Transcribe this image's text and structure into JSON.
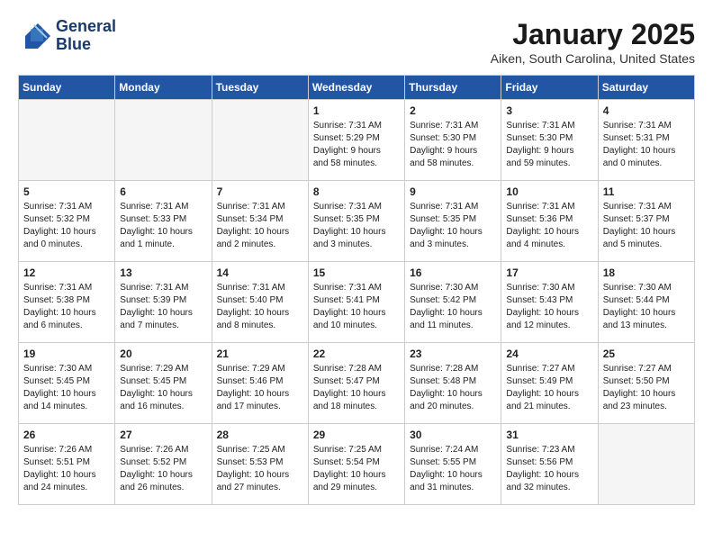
{
  "header": {
    "logo_line1": "General",
    "logo_line2": "Blue",
    "title": "January 2025",
    "subtitle": "Aiken, South Carolina, United States"
  },
  "weekdays": [
    "Sunday",
    "Monday",
    "Tuesday",
    "Wednesday",
    "Thursday",
    "Friday",
    "Saturday"
  ],
  "weeks": [
    [
      {
        "day": "",
        "info": ""
      },
      {
        "day": "",
        "info": ""
      },
      {
        "day": "",
        "info": ""
      },
      {
        "day": "1",
        "info": "Sunrise: 7:31 AM\nSunset: 5:29 PM\nDaylight: 9 hours\nand 58 minutes."
      },
      {
        "day": "2",
        "info": "Sunrise: 7:31 AM\nSunset: 5:30 PM\nDaylight: 9 hours\nand 58 minutes."
      },
      {
        "day": "3",
        "info": "Sunrise: 7:31 AM\nSunset: 5:30 PM\nDaylight: 9 hours\nand 59 minutes."
      },
      {
        "day": "4",
        "info": "Sunrise: 7:31 AM\nSunset: 5:31 PM\nDaylight: 10 hours\nand 0 minutes."
      }
    ],
    [
      {
        "day": "5",
        "info": "Sunrise: 7:31 AM\nSunset: 5:32 PM\nDaylight: 10 hours\nand 0 minutes."
      },
      {
        "day": "6",
        "info": "Sunrise: 7:31 AM\nSunset: 5:33 PM\nDaylight: 10 hours\nand 1 minute."
      },
      {
        "day": "7",
        "info": "Sunrise: 7:31 AM\nSunset: 5:34 PM\nDaylight: 10 hours\nand 2 minutes."
      },
      {
        "day": "8",
        "info": "Sunrise: 7:31 AM\nSunset: 5:35 PM\nDaylight: 10 hours\nand 3 minutes."
      },
      {
        "day": "9",
        "info": "Sunrise: 7:31 AM\nSunset: 5:35 PM\nDaylight: 10 hours\nand 3 minutes."
      },
      {
        "day": "10",
        "info": "Sunrise: 7:31 AM\nSunset: 5:36 PM\nDaylight: 10 hours\nand 4 minutes."
      },
      {
        "day": "11",
        "info": "Sunrise: 7:31 AM\nSunset: 5:37 PM\nDaylight: 10 hours\nand 5 minutes."
      }
    ],
    [
      {
        "day": "12",
        "info": "Sunrise: 7:31 AM\nSunset: 5:38 PM\nDaylight: 10 hours\nand 6 minutes."
      },
      {
        "day": "13",
        "info": "Sunrise: 7:31 AM\nSunset: 5:39 PM\nDaylight: 10 hours\nand 7 minutes."
      },
      {
        "day": "14",
        "info": "Sunrise: 7:31 AM\nSunset: 5:40 PM\nDaylight: 10 hours\nand 8 minutes."
      },
      {
        "day": "15",
        "info": "Sunrise: 7:31 AM\nSunset: 5:41 PM\nDaylight: 10 hours\nand 10 minutes."
      },
      {
        "day": "16",
        "info": "Sunrise: 7:30 AM\nSunset: 5:42 PM\nDaylight: 10 hours\nand 11 minutes."
      },
      {
        "day": "17",
        "info": "Sunrise: 7:30 AM\nSunset: 5:43 PM\nDaylight: 10 hours\nand 12 minutes."
      },
      {
        "day": "18",
        "info": "Sunrise: 7:30 AM\nSunset: 5:44 PM\nDaylight: 10 hours\nand 13 minutes."
      }
    ],
    [
      {
        "day": "19",
        "info": "Sunrise: 7:30 AM\nSunset: 5:45 PM\nDaylight: 10 hours\nand 14 minutes."
      },
      {
        "day": "20",
        "info": "Sunrise: 7:29 AM\nSunset: 5:45 PM\nDaylight: 10 hours\nand 16 minutes."
      },
      {
        "day": "21",
        "info": "Sunrise: 7:29 AM\nSunset: 5:46 PM\nDaylight: 10 hours\nand 17 minutes."
      },
      {
        "day": "22",
        "info": "Sunrise: 7:28 AM\nSunset: 5:47 PM\nDaylight: 10 hours\nand 18 minutes."
      },
      {
        "day": "23",
        "info": "Sunrise: 7:28 AM\nSunset: 5:48 PM\nDaylight: 10 hours\nand 20 minutes."
      },
      {
        "day": "24",
        "info": "Sunrise: 7:27 AM\nSunset: 5:49 PM\nDaylight: 10 hours\nand 21 minutes."
      },
      {
        "day": "25",
        "info": "Sunrise: 7:27 AM\nSunset: 5:50 PM\nDaylight: 10 hours\nand 23 minutes."
      }
    ],
    [
      {
        "day": "26",
        "info": "Sunrise: 7:26 AM\nSunset: 5:51 PM\nDaylight: 10 hours\nand 24 minutes."
      },
      {
        "day": "27",
        "info": "Sunrise: 7:26 AM\nSunset: 5:52 PM\nDaylight: 10 hours\nand 26 minutes."
      },
      {
        "day": "28",
        "info": "Sunrise: 7:25 AM\nSunset: 5:53 PM\nDaylight: 10 hours\nand 27 minutes."
      },
      {
        "day": "29",
        "info": "Sunrise: 7:25 AM\nSunset: 5:54 PM\nDaylight: 10 hours\nand 29 minutes."
      },
      {
        "day": "30",
        "info": "Sunrise: 7:24 AM\nSunset: 5:55 PM\nDaylight: 10 hours\nand 31 minutes."
      },
      {
        "day": "31",
        "info": "Sunrise: 7:23 AM\nSunset: 5:56 PM\nDaylight: 10 hours\nand 32 minutes."
      },
      {
        "day": "",
        "info": ""
      }
    ]
  ]
}
